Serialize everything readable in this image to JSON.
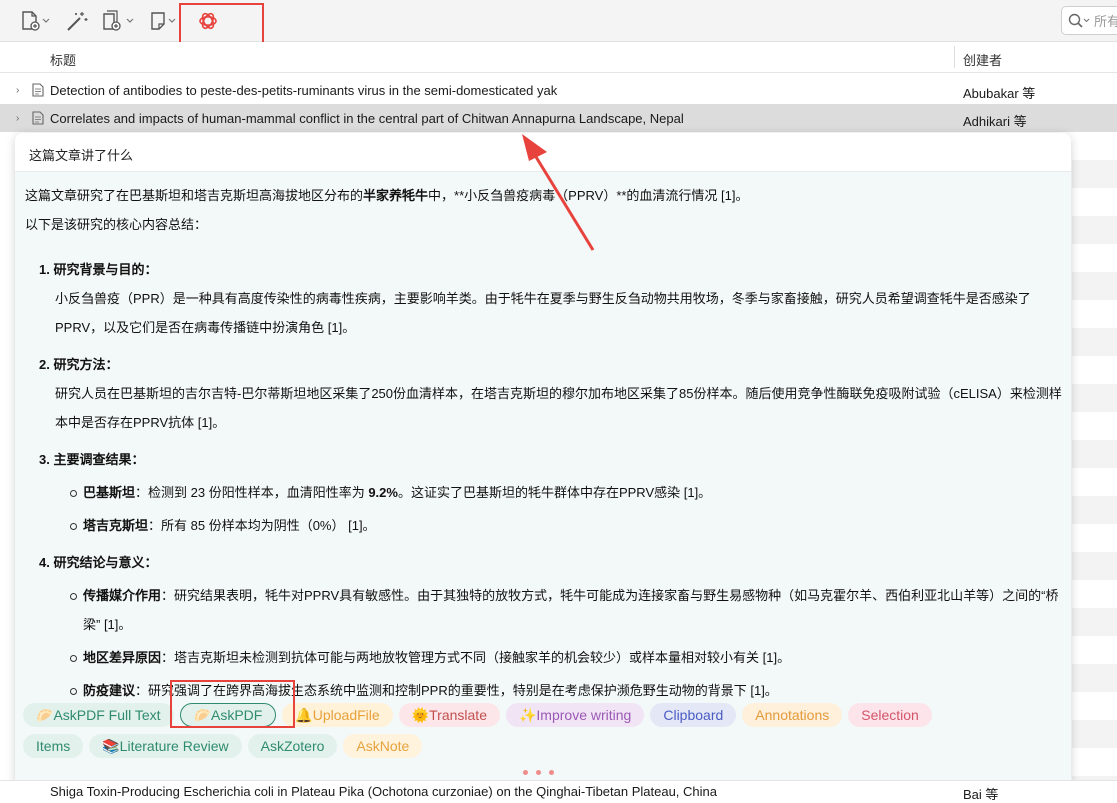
{
  "columns": {
    "title": "标题",
    "creator": "创建者"
  },
  "search": {
    "placeholder": "所有"
  },
  "rows": [
    {
      "title": "Detection of antibodies to peste-des-petits-ruminants virus in the semi-domesticated yak",
      "creator": "Abubakar 等"
    },
    {
      "title": "Correlates and impacts of human-mammal conflict in the central part of Chitwan Annapurna Landscape, Nepal",
      "creator": "Adhikari 等"
    }
  ],
  "bottom_row": {
    "title": "Shiga Toxin-Producing Escherichia coli in Plateau Pika (Ochotona curzoniae) on the Qinghai-Tibetan Plateau, China",
    "creator": "Bai 等"
  },
  "popup": {
    "title": "这篇文章讲了什么",
    "intro_pre": "这篇文章研究了在巴基斯坦和塔吉克斯坦高海拔地区分布的",
    "intro_bold": "半家养牦牛",
    "intro_post": "中，**小反刍兽疫病毒（PPRV）**的血清流行情况 [1]。",
    "summary_label": "以下是该研究的核心内容总结：",
    "s1_head": "1. 研究背景与目的：",
    "s1_body": "小反刍兽疫（PPR）是一种具有高度传染性的病毒性疾病，主要影响羊类。由于牦牛在夏季与野生反刍动物共用牧场，冬季与家畜接触，研究人员希望调查牦牛是否感染了PPRV，以及它们是否在病毒传播链中扮演角色 [1]。",
    "s2_head": "2. 研究方法：",
    "s2_body": "研究人员在巴基斯坦的吉尔吉特-巴尔蒂斯坦地区采集了250份血清样本，在塔吉克斯坦的穆尔加布地区采集了85份样本。随后使用竞争性酶联免疫吸附试验（cELISA）来检测样本中是否存在PPRV抗体 [1]。",
    "s3_head": "3. 主要调查结果：",
    "s3_b1_bold": "巴基斯坦",
    "s3_b1_pre": "：检测到 23 份阳性样本，血清阳性率为 ",
    "s3_b1_rate": "9.2%",
    "s3_b1_post": "。这证实了巴基斯坦的牦牛群体中存在PPRV感染 [1]。",
    "s3_b2_bold": "塔吉克斯坦",
    "s3_b2_text": "：所有 85 份样本均为阴性（0%） [1]。",
    "s4_head": "4. 研究结论与意义：",
    "s4_b1_bold": "传播媒介作用",
    "s4_b1_text": "：研究结果表明，牦牛对PPRV具有敏感性。由于其独特的放牧方式，牦牛可能成为连接家畜与野生易感物种（如马克霍尔羊、西伯利亚北山羊等）之间的“桥梁” [1]。",
    "s4_b2_bold": "地区差异原因",
    "s4_b2_text": "：塔吉克斯坦未检测到抗体可能与两地放牧管理方式不同（接触家羊的机会较少）或样本量相对较小有关 [1]。",
    "s4_b3_bold": "防疫建议",
    "s4_b3_text": "：研究强调了在跨界高海拔生态系统中监测和控制PPR的重要性，特别是在考虑保护濒危野生动物的背景下 [1]。"
  },
  "buttons": {
    "row1": [
      {
        "id": "askpdf-full-text",
        "icon": "🥟",
        "label": "AskPDF Full Text"
      },
      {
        "id": "askpdf",
        "icon": "🥟",
        "label": "AskPDF"
      },
      {
        "id": "uploadfile",
        "icon": "🔔",
        "label": "UploadFile"
      },
      {
        "id": "translate",
        "icon": "🌞",
        "label": "Translate"
      },
      {
        "id": "improve-writing",
        "icon": "✨",
        "label": "Improve writing"
      },
      {
        "id": "clipboard",
        "icon": "",
        "label": "Clipboard"
      },
      {
        "id": "annotations",
        "icon": "",
        "label": "Annotations"
      },
      {
        "id": "selection",
        "icon": "",
        "label": "Selection"
      }
    ],
    "row2": [
      {
        "id": "items",
        "icon": "",
        "label": "Items"
      },
      {
        "id": "literature-review",
        "icon": "📚",
        "label": "Literature Review"
      },
      {
        "id": "askzotero",
        "icon": "",
        "label": "AskZotero"
      },
      {
        "id": "asknote",
        "icon": "",
        "label": "AskNote"
      }
    ]
  },
  "colors": {
    "highlight": "#e8423d",
    "openai": "#e8423d",
    "askpdf_bg": "#e3f1ec",
    "askpdf_fg": "#2e8b6e",
    "uploadfile_bg": "#fff2d9",
    "uploadfile_fg": "#e8a03a",
    "translate_bg": "#fde6ea",
    "translate_fg": "#c0504d",
    "improve_bg": "#f1e4f5",
    "improve_fg": "#9b59b6",
    "clipboard_bg": "#e4e7f6",
    "clipboard_fg": "#4a5cc4",
    "annotations_bg": "#fff0db",
    "annotations_fg": "#e39a3a",
    "selection_bg": "#fde4ea",
    "selection_fg": "#d2556a",
    "items_bg": "#e3f1ec",
    "items_fg": "#2e8b6e",
    "asknote_bg": "#fff3dd",
    "asknote_fg": "#e6a23c"
  }
}
